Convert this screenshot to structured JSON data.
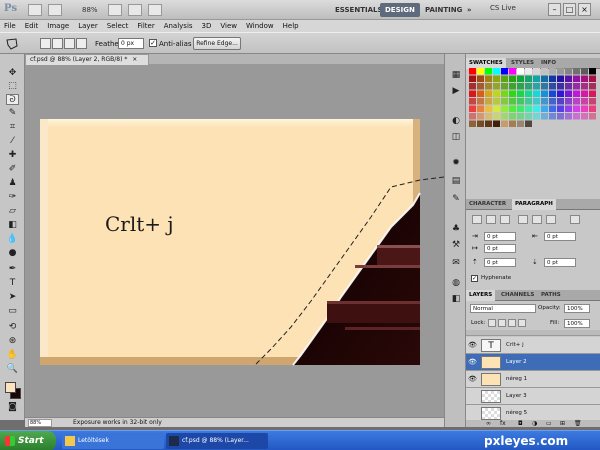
{
  "app": {
    "logo": "Ps",
    "zoom": "88%",
    "workspaces": [
      "ESSENTIALS",
      "DESIGN",
      "PAINTING"
    ],
    "active_workspace": "DESIGN",
    "more": "»",
    "cs_live": "CS Live"
  },
  "menu": [
    "File",
    "Edit",
    "Image",
    "Layer",
    "Select",
    "Filter",
    "Analysis",
    "3D",
    "View",
    "Window",
    "Help"
  ],
  "options": {
    "feather_label": "Feather:",
    "feather_value": "0 px",
    "antialias_label": "Anti-alias",
    "antialias_checked": "✓",
    "refine_edge": "Refine Edge..."
  },
  "document": {
    "tab_title": "cf.psd @ 88% (Layer 2, RGB/8) *",
    "canvas_text": "Crlt+ j",
    "status_zoom": "88%",
    "status_message": "Exposure works in 32-bit only"
  },
  "swatches_panel": {
    "tabs": [
      "SWATCHES",
      "STYLES",
      "INFO"
    ]
  },
  "character_panel": {
    "tabs": [
      "CHARACTER",
      "PARAGRAPH"
    ],
    "indent_left": "0 pt",
    "indent_right": "0 pt",
    "indent_first": "0 pt",
    "space_before": "0 pt",
    "space_after": "0 pt",
    "hyphenate_label": "Hyphenate",
    "hyphenate_checked": "✓"
  },
  "layers_panel": {
    "tabs": [
      "LAYERS",
      "CHANNELS",
      "PATHS"
    ],
    "blend_mode": "Normal",
    "opacity_label": "Opacity:",
    "opacity_value": "100%",
    "lock_label": "Lock:",
    "fill_label": "Fill:",
    "fill_value": "100%",
    "layers": [
      {
        "name": "Crlt+ j",
        "type": "text"
      },
      {
        "name": "Layer 2",
        "type": "cream",
        "selected": true
      },
      {
        "name": "néreg 1",
        "type": "cream"
      },
      {
        "name": "Layer 3",
        "type": "transparent"
      },
      {
        "name": "néreg 5",
        "type": "transparent"
      }
    ]
  },
  "taskbar": {
    "start": "Start",
    "tasks": [
      "Letöltések",
      "cf.psd @ 88% (Layer..."
    ],
    "watermark_main": "pxleyes",
    "watermark_dot": ".",
    "watermark_tld": "com"
  },
  "colors": {
    "foreground": "#fbe3bf",
    "background": "#1a0606",
    "selection": "#3f6cb6"
  }
}
